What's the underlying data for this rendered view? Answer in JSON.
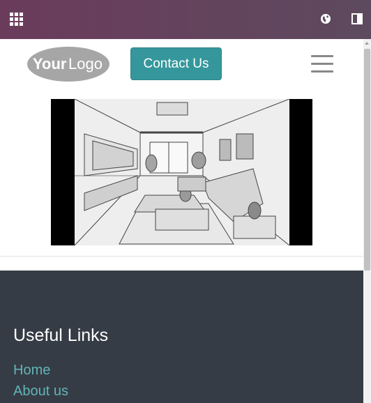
{
  "topbar": {
    "apps_icon": "apps-grid-icon",
    "globe_icon": "globe-icon",
    "panel_icon": "sidebar-toggle-icon",
    "background": "#6b3b5c"
  },
  "header": {
    "logo": {
      "text_your": "Your",
      "text_logo": "Logo"
    },
    "contact_button": "Contact Us",
    "menu_icon": "hamburger-menu-icon",
    "accent_color": "#35979c"
  },
  "main": {
    "hero_image": "living-room-perspective-sketch"
  },
  "footer": {
    "title": "Useful Links",
    "links": [
      "Home",
      "About us"
    ],
    "background": "#363c45",
    "link_color": "#5fb5b9"
  }
}
